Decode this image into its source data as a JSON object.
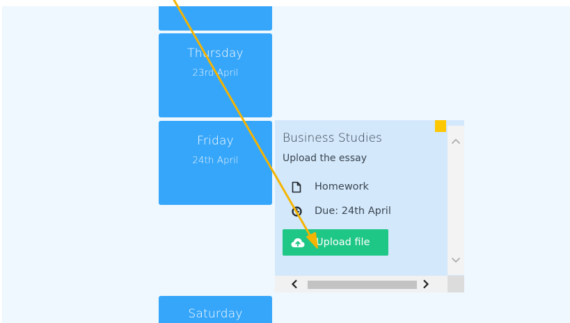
{
  "days": {
    "thursday": {
      "name": "Thursday",
      "date": "23rd April"
    },
    "friday": {
      "name": "Friday",
      "date": "24th April"
    },
    "saturday": {
      "name": "Saturday"
    }
  },
  "event": {
    "title": "Business Studies",
    "description": "Upload the essay",
    "type": "Homework",
    "due": "Due: 24th April",
    "upload_label": "Upload file",
    "marker_color": "#fdc701"
  },
  "icons": {
    "type": "document-icon",
    "due": "clock-icon",
    "upload": "cloud-upload-icon",
    "scroll_up": "chevron-up-icon",
    "scroll_down": "chevron-down-icon",
    "scroll_left": "chevron-left-icon",
    "scroll_right": "chevron-right-icon"
  },
  "colors": {
    "day_card": "#36a6fa",
    "event_panel": "#d3e8fb",
    "upload_button": "#1fc786",
    "background": "#eff8ff"
  }
}
